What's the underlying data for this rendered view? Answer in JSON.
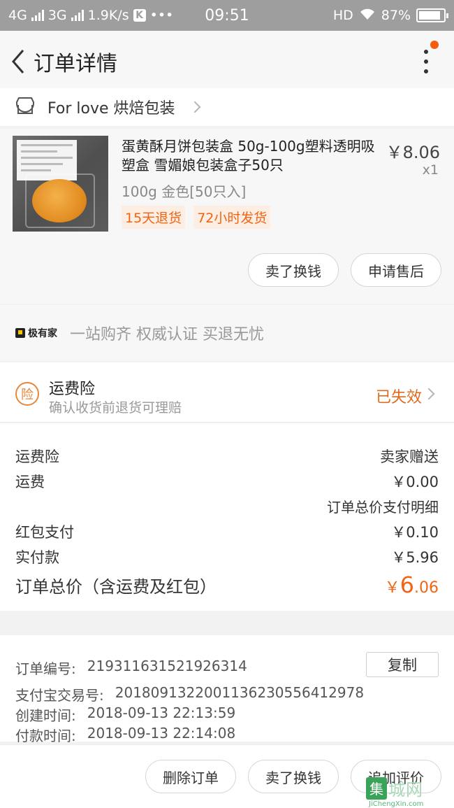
{
  "status_bar": {
    "net1": "4G",
    "net2": "3G",
    "speed": "1.9K/s",
    "k_label": "K",
    "dots": "•••",
    "time": "09:51",
    "hd": "HD",
    "battery_pct": "87%",
    "battery_level": 0.87
  },
  "nav": {
    "title": "订单详情"
  },
  "shop": {
    "name": "For love 烘焙包装"
  },
  "product": {
    "title": "蛋黄酥月饼包装盒 50g-100g塑料透明吸塑盒 雪媚娘包装盒子50只",
    "price": "￥8.06",
    "qty": "x1",
    "spec": "100g 金色[50只入]",
    "tags": [
      "15天退货",
      "72小时发货"
    ],
    "btn_sell": "卖了换钱",
    "btn_after_sale": "申请售后"
  },
  "promo": {
    "logo": "极有家",
    "text": "一站购齐 权威认证 买退无忧"
  },
  "insurance": {
    "icon_char": "险",
    "title": "运费险",
    "desc": "确认收货前退货可理赔",
    "status": "已失效"
  },
  "costs": {
    "rows": [
      {
        "label": "运费险",
        "value": "卖家赠送"
      },
      {
        "label": "运费",
        "value": "￥0.00"
      }
    ],
    "detail_link": "订单总价支付明细",
    "rows2": [
      {
        "label": "红包支付",
        "value": "￥0.10"
      },
      {
        "label": "实付款",
        "value": "￥5.96"
      }
    ],
    "total_label": "订单总价（含运费及红包）",
    "total_symbol": "￥",
    "total_int": "6",
    "total_dec": ".06"
  },
  "order_info": {
    "order_no_label": "订单编号:",
    "order_no": "219311631521926314",
    "copy_btn": "复制",
    "alipay_label": "支付宝交易号:",
    "alipay_no": "2018091322001136230556412978",
    "created_label": "创建时间:",
    "created": "2018-09-13 22:13:59",
    "paid_label": "付款时间:",
    "paid": "2018-09-13 22:14:08"
  },
  "footer": {
    "delete": "删除订单",
    "sell": "卖了换钱",
    "review": "追加评价"
  },
  "watermark": {
    "badge": "集",
    "text": "城网",
    "url": "JiChengXin.com"
  }
}
